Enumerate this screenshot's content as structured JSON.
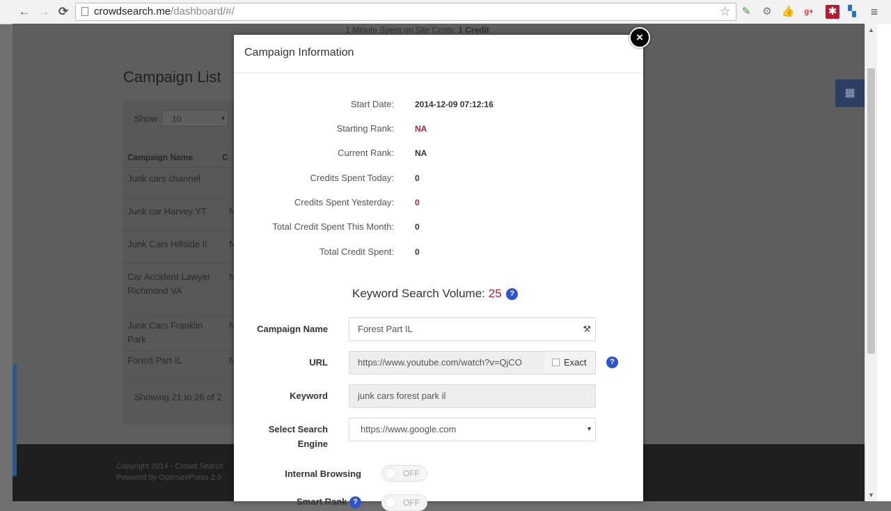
{
  "browser": {
    "url_host": "crowdsearch.me",
    "url_path": "/dashboard/#/"
  },
  "page": {
    "notice_prefix": "1 Minute Spent on Site Costs:",
    "notice_value": "1 Credit",
    "list_title": "Campaign List",
    "show_label": "Show",
    "show_value": "10",
    "col_campaign_name": "Campaign Name",
    "col_second": "C",
    "rows": [
      {
        "name": "Junk cars channel",
        "second": ""
      },
      {
        "name": "Junk car Harvey YT",
        "second": "N"
      },
      {
        "name": "Junk Cars Hillside Il",
        "second": "N"
      },
      {
        "name": "Car Accident Lawyer Richmond VA",
        "second": "N"
      },
      {
        "name": "Junk Cars Franklin Park",
        "second": "N"
      },
      {
        "name": "Forest Part IL",
        "second": "N"
      }
    ],
    "showing": "Showing 21 to 26  of  2",
    "copyright_line1": "Copyright 2014 - Crowd Search",
    "copyright_line2": "Powered by OptimizePress 2.0"
  },
  "modal": {
    "title": "Campaign Information",
    "info": [
      {
        "label": "Start Date:",
        "value": "2014-12-09 07:12:16"
      },
      {
        "label": "Starting Rank:",
        "value": "NA"
      },
      {
        "label": "Current Rank:",
        "value": "NA"
      },
      {
        "label": "Credits Spent Today:",
        "value": "0"
      },
      {
        "label": "Credits Spent Yesterday:",
        "value": "0"
      },
      {
        "label": "Total Credit Spent This Month:",
        "value": "0"
      },
      {
        "label": "Total Credit Spent:",
        "value": "0"
      }
    ],
    "ksv_label": "Keyword Search Volume:",
    "ksv_value": "25",
    "help_glyph": "?",
    "form": {
      "campaign_name_label": "Campaign Name",
      "campaign_name_value": "Forest Part IL",
      "url_label": "URL",
      "url_value": "https://www.youtube.com/watch?v=QjCO",
      "exact_label": "Exact",
      "keyword_label": "Keyword",
      "keyword_value": "junk cars forest park il",
      "engine_label_line1": "Select Search",
      "engine_label_line2": "Engine",
      "engine_value": "https://www.google.com",
      "internal_browsing_label": "Internal Browsing",
      "internal_browsing_state": "OFF",
      "smart_rank_label": "Smart Rank",
      "smart_rank_state": "OFF"
    }
  },
  "colors": {
    "accent_red": "#a3243a",
    "help_blue": "#2f54c8"
  },
  "icons": {
    "close": "×",
    "caret": "▾",
    "back": "←",
    "forward": "→",
    "reload": "C",
    "star": "☆",
    "menu": "≡"
  }
}
